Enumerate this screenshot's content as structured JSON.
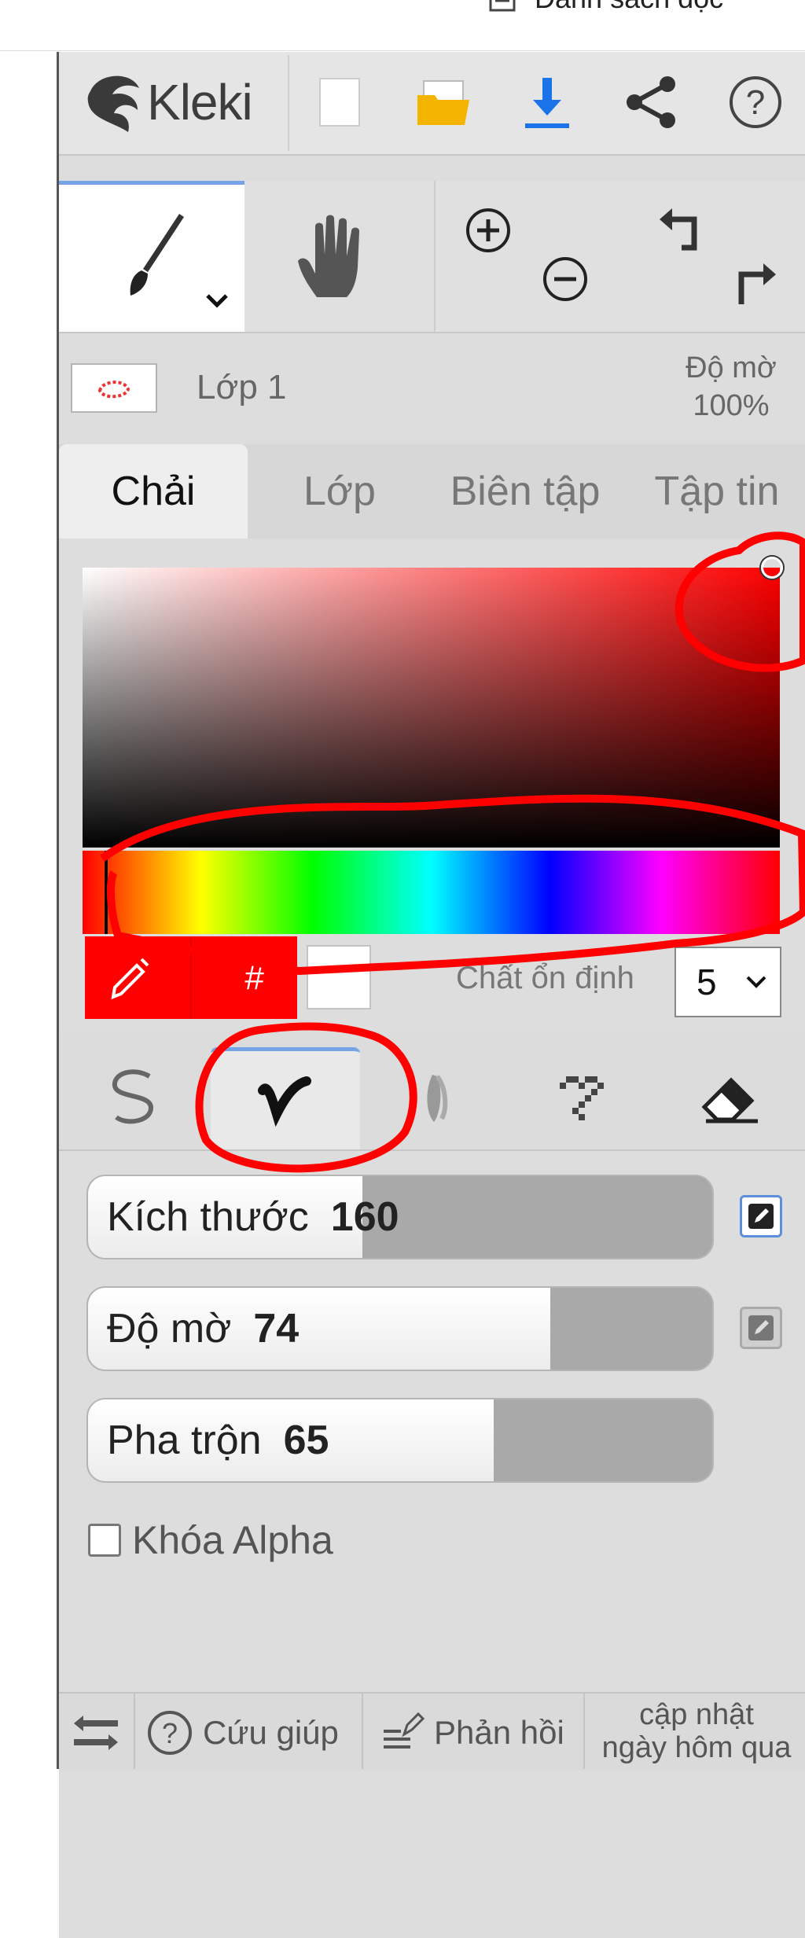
{
  "browser": {
    "reading_list_label": "Danh sách đọc"
  },
  "app": {
    "logo_text": "Kleki",
    "header_icons": [
      "new-file-icon",
      "open-folder-icon",
      "download-icon",
      "share-icon",
      "help-icon"
    ]
  },
  "tools": {
    "items": [
      "brush-icon",
      "hand-icon",
      "zoom-in-icon",
      "zoom-out-icon",
      "undo-icon",
      "redo-icon"
    ]
  },
  "layer": {
    "name": "Lớp 1",
    "opacity_label": "Độ mờ",
    "opacity_value": "100%"
  },
  "tabs": [
    {
      "label": "Chải",
      "active": true
    },
    {
      "label": "Lớp",
      "active": false
    },
    {
      "label": "Biên tập",
      "active": false
    },
    {
      "label": "Tập tin",
      "active": false
    }
  ],
  "color": {
    "current": "#ff0000",
    "hash_label": "#",
    "stabilizer_label": "Chất ổn định",
    "stabilizer_value": "5"
  },
  "brush_types": [
    "pen-icon",
    "blend-brush-icon",
    "sketchy-brush-icon",
    "pixel-brush-icon",
    "eraser-icon"
  ],
  "sliders": {
    "size": {
      "label": "Kích thước",
      "value": "160",
      "fraction": 0.44
    },
    "opacity": {
      "label": "Độ mờ",
      "value": "74",
      "fraction": 0.74
    },
    "blend": {
      "label": "Pha trộn",
      "value": "65",
      "fraction": 0.65
    }
  },
  "lock_alpha": {
    "label": "Khóa Alpha",
    "checked": false
  },
  "footer": {
    "help_label": "Cứu giúp",
    "feedback_label": "Phản hồi",
    "update_line1": "cập nhật",
    "update_line2": "ngày hôm qua"
  },
  "annotation_color": "#ff0000"
}
